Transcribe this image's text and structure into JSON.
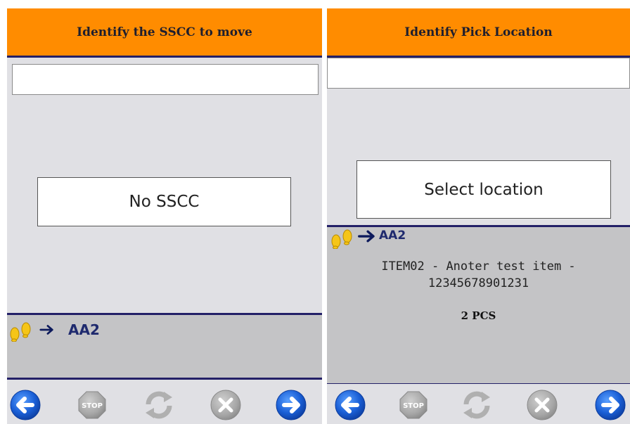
{
  "left": {
    "header": "Identify the SSCC to move",
    "input_value": "",
    "button_label": "No SSCC",
    "location": "AA2"
  },
  "right": {
    "header": "Identify Pick Location",
    "input_value": "",
    "button_label": "Select location",
    "location": "AA2",
    "item_line1": "ITEM02 - Anoter test item -",
    "item_line2": "12345678901231",
    "quantity": "2 PCS"
  },
  "toolbar_icons": [
    "back-arrow-icon",
    "stop-icon",
    "refresh-icon",
    "cancel-icon",
    "forward-arrow-icon"
  ],
  "colors": {
    "header": "#ff8c00",
    "divider": "#232067",
    "background": "#e0e0e4",
    "info_bar": "#c4c4c6",
    "nav_blue": "#1a5fd6",
    "disabled_gray": "#a6a6a6"
  }
}
